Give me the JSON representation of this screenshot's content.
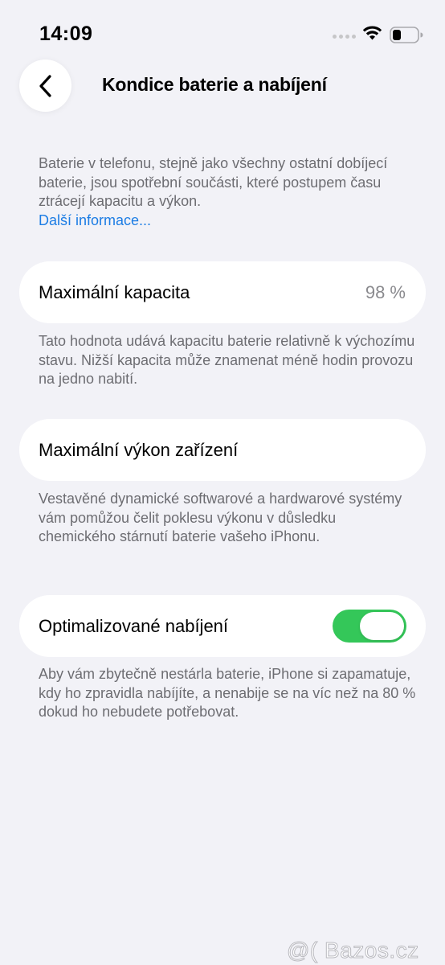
{
  "status_bar": {
    "time": "14:09",
    "signal_icon": "cellular-signal-icon",
    "wifi_icon": "wifi-icon",
    "battery_icon": "battery-icon",
    "battery_level": 0.35
  },
  "nav": {
    "back_icon": "chevron-left-icon",
    "title": "Kondice baterie a nabíjení"
  },
  "intro": {
    "text": "Baterie v telefonu, stejně jako všechny ostatní dobíjecí baterie, jsou spotřební součásti, které postupem času ztrácejí kapacitu a výkon.",
    "link": "Další informace..."
  },
  "capacity": {
    "label": "Maximální kapacita",
    "value": "98 %",
    "footnote": "Tato hodnota udává kapacitu baterie relativně k výchozímu stavu. Nižší kapacita může znamenat méně hodin provozu na jedno nabití."
  },
  "performance": {
    "label": "Maximální výkon zařízení",
    "footnote": "Vestavěné dynamické softwarové a hardwarové systémy vám pomůžou čelit poklesu výkonu v důsledku chemického stárnutí baterie vašeho iPhonu."
  },
  "optimized_charging": {
    "label": "Optimalizované nabíjení",
    "enabled": true,
    "footnote": "Aby vám zbytečně nestárla baterie, iPhone si zapamatuje, kdy ho zpravidla nabíjíte, a nenabije se na víc než na 80 % dokud ho nebudete potřebovat."
  },
  "colors": {
    "background": "#f2f2f7",
    "link": "#1b7ce4",
    "toggle_on": "#34c759",
    "secondary_text": "#6d6d72"
  },
  "watermark": {
    "text": "@( Bazos.cz"
  }
}
